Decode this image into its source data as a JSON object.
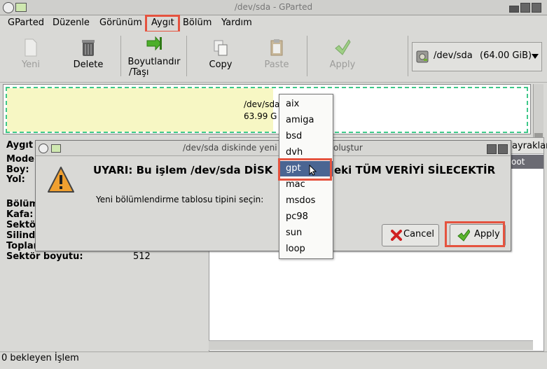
{
  "window": {
    "title": "/dev/sda - GParted"
  },
  "menu": [
    "GParted",
    "Düzenle",
    "Görünüm",
    "Aygıt",
    "Bölüm",
    "Yardım"
  ],
  "toolbar": {
    "new": "Yeni",
    "delete": "Delete",
    "resize1": "Boyutlandır",
    "resize2": "/Taşı",
    "copy": "Copy",
    "paste": "Paste",
    "apply": "Apply"
  },
  "device": {
    "name": "/dev/sda",
    "size": "(64.00 GiB)"
  },
  "graph": {
    "label1": "/dev/sda",
    "label2": "63.99 G"
  },
  "left_panel": {
    "header": "Aygıt",
    "rows": [
      "Mode",
      "Boy:",
      "Yol:",
      "Bölüm",
      "Kafa:",
      "Sektö",
      "Silindi",
      "Toplam",
      "Sektör boyutu:"
    ],
    "sector_size_value": "512"
  },
  "right_panel": {
    "header_tail": "ayraklar",
    "row_tail": "oot"
  },
  "status": "0 bekleyen İşlem",
  "dialog": {
    "title_left": "/dev/sda diskinde yeni b",
    "title_right": "oluştur",
    "warning_left": "UYARI: Bu işlem /dev/sda DİSK",
    "warning_right": "eki TÜM VERİYİ SİLECEKTİR",
    "prompt": "Yeni bölümlendirme tablosu tipini seçin:",
    "cancel": "Cancel",
    "apply": "Apply"
  },
  "dropdown": {
    "options": [
      "aix",
      "amiga",
      "bsd",
      "dvh",
      "gpt",
      "mac",
      "msdos",
      "pc98",
      "sun",
      "loop"
    ],
    "selected": "gpt"
  },
  "colors": {
    "highlight": "#e5533f",
    "selection": "#4a6592",
    "unallocated": "#f7f7c4",
    "border_dashed": "#3ec889"
  }
}
